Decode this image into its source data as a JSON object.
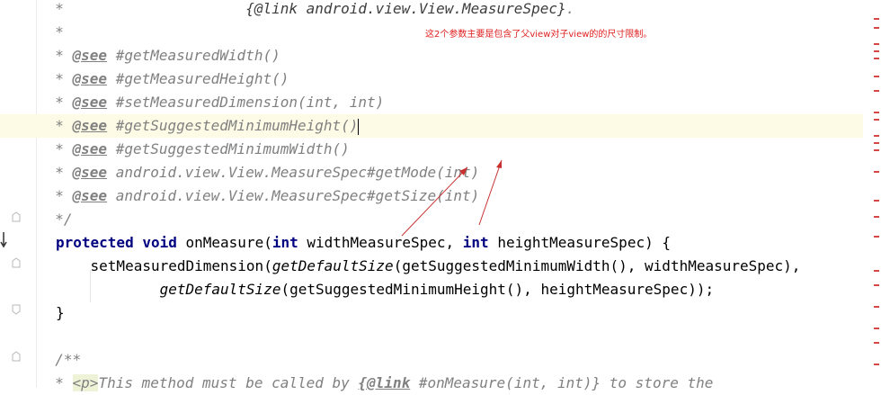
{
  "editor": {
    "lines": [
      {
        "y": 0,
        "segments": [
          {
            "cls": "cm",
            "key": "l0a"
          },
          {
            "cls": "ref",
            "key": "l0b"
          },
          {
            "cls": "cm",
            "key": "l0c"
          }
        ]
      },
      {
        "y": 1,
        "segments": [
          {
            "cls": "cm",
            "key": "l1a"
          }
        ]
      },
      {
        "y": 2,
        "segments": [
          {
            "cls": "cm",
            "key": "star"
          },
          {
            "cls": "tag",
            "key": "see"
          },
          {
            "cls": "cm",
            "key": "l2b"
          }
        ]
      },
      {
        "y": 3,
        "segments": [
          {
            "cls": "cm",
            "key": "star"
          },
          {
            "cls": "tag",
            "key": "see"
          },
          {
            "cls": "cm",
            "key": "l3b"
          }
        ]
      },
      {
        "y": 4,
        "segments": [
          {
            "cls": "cm",
            "key": "star"
          },
          {
            "cls": "tag",
            "key": "see"
          },
          {
            "cls": "cm",
            "key": "l4b"
          }
        ]
      },
      {
        "y": 5,
        "segments": [
          {
            "cls": "cm",
            "key": "star"
          },
          {
            "cls": "tag",
            "key": "see"
          },
          {
            "cls": "cm",
            "key": "l5b"
          }
        ]
      },
      {
        "y": 6,
        "segments": [
          {
            "cls": "cm",
            "key": "star"
          },
          {
            "cls": "tag",
            "key": "see"
          },
          {
            "cls": "cm",
            "key": "l6b"
          }
        ]
      },
      {
        "y": 7,
        "segments": [
          {
            "cls": "cm",
            "key": "star"
          },
          {
            "cls": "tag",
            "key": "see"
          },
          {
            "cls": "cm",
            "key": "l7b"
          }
        ]
      },
      {
        "y": 8,
        "segments": [
          {
            "cls": "cm",
            "key": "star"
          },
          {
            "cls": "tag",
            "key": "see"
          },
          {
            "cls": "cm",
            "key": "l8b"
          }
        ]
      },
      {
        "y": 9,
        "segments": [
          {
            "cls": "cm",
            "key": "l9a"
          }
        ]
      }
    ],
    "text": {
      "l0a": "  *                     ",
      "l0b": "{@link android.view.View.MeasureSpec}",
      "l0c": ".",
      "l1a": "  *",
      "star": "  * ",
      "see": "@see",
      "l2b": " #getMeasuredWidth()",
      "l3b": " #getMeasuredHeight()",
      "l4b": " #setMeasuredDimension(int, int)",
      "l5b": " #getSuggestedMinimumHeight()",
      "l6b": " #getSuggestedMinimumWidth()",
      "l7b": " android.view.View.MeasureSpec#getMode(int)",
      "l8b": " android.view.View.MeasureSpec#getSize(int)",
      "l9a": "  */"
    },
    "code": {
      "protected": "protected",
      "void": "void",
      "method_sig": " onMeasure(",
      "int1": "int",
      "p1": " widthMeasureSpec, ",
      "int2": "int",
      "p2": " heightMeasureSpec) {",
      "call1_a": "    setMeasuredDimension(",
      "call1_b": "getDefaultSize",
      "call1_c": "(getSuggestedMinimumWidth(), widthMeasureSpec),",
      "call2_a": "            ",
      "call2_b": "getDefaultSize",
      "call2_c": "(getSuggestedMinimumHeight(), heightMeasureSpec));",
      "close": "}",
      "doc_open": "  /**",
      "last_a": "  * ",
      "last_p": "<p>",
      "last_b": "This method must be called by ",
      "last_link": "{@link",
      "last_c": " #onMeasure(int, int)} to store the"
    }
  },
  "annotation": {
    "text": "这2个参数主要是包含了父view对子view的的尺寸限制。",
    "color": "#e02020"
  },
  "colors": {
    "comment": "#808080",
    "keyword": "#000080",
    "current_line": "#fdfbe5",
    "error_mark": "#d64646"
  }
}
